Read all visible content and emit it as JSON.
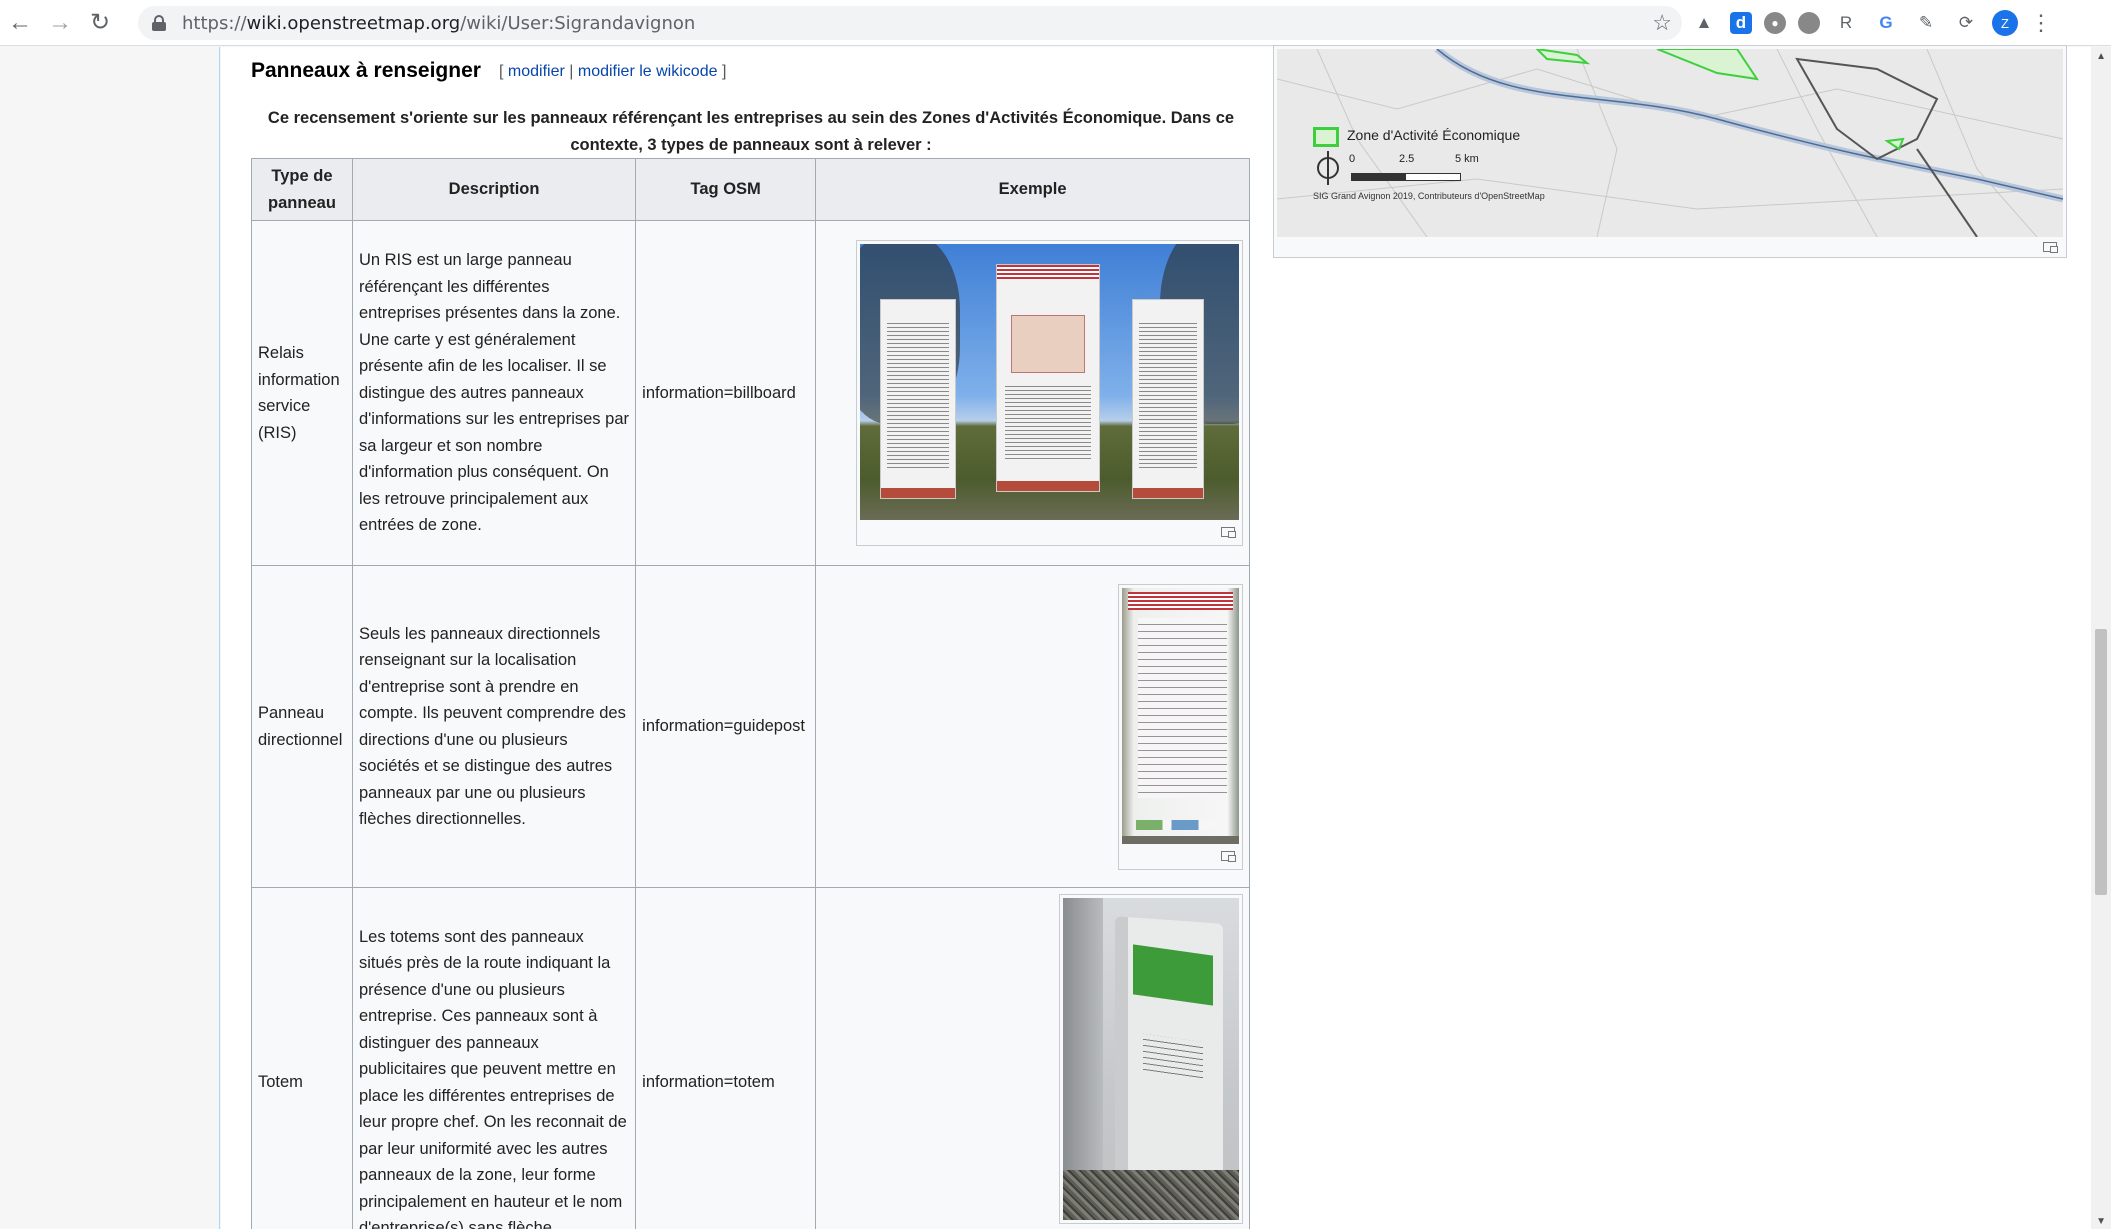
{
  "browser": {
    "url_scheme": "https://",
    "url_host": "wiki.openstreetmap.org",
    "url_path": "/wiki/User:Sigrandavignon",
    "profile_initial": "Z"
  },
  "section": {
    "title": "Panneaux à renseigner",
    "edit_open": "[",
    "edit_link": "modifier",
    "edit_sep": "|",
    "edit_wikicode_link": "modifier le wikicode",
    "edit_close": "]",
    "intro": "Ce recensement s'oriente sur les panneaux référençant les entreprises au sein des Zones d'Activités Économique. Dans ce contexte, 3 types de panneaux sont à relever :"
  },
  "table": {
    "headers": {
      "type": "Type de panneau",
      "description": "Description",
      "tag": "Tag OSM",
      "example": "Exemple"
    },
    "rows": [
      {
        "type": "Relais information service (RIS)",
        "description": "Un RIS est un large panneau référençant les différentes entreprises présentes dans la zone. Une carte y est généralement présente afin de les localiser. Il se distingue des autres panneaux d'informations sur les entreprises par sa largeur et son nombre d'information plus conséquent. On les retrouve principalement aux entrées de zone.",
        "tag": "information=billboard"
      },
      {
        "type": "Panneau directionnel",
        "description": "Seuls les panneaux directionnels renseignant sur la localisation d'entreprise sont à prendre en compte. Ils peuvent comprendre des directions d'une ou plusieurs sociétés et se distingue des autres panneaux par une ou plusieurs flèches directionnelles.",
        "tag": "information=guidepost"
      },
      {
        "type": "Totem",
        "description": "Les totems sont des panneaux situés près de la route indiquant la présence d'une ou plusieurs entreprise. Ces panneaux sont à distinguer des panneaux publicitaires que peuvent mettre en place les différentes entreprises de leur propre chef. On les reconnait de par leur uniformité avec les autres panneaux de la zone, leur forme principalement en hauteur et le nom d'entreprise(s) sans flèche.",
        "tag": "information=totem"
      }
    ]
  },
  "map": {
    "legend_label": "Zone d'Activité Économique",
    "scale_0": "0",
    "scale_mid": "2.5",
    "scale_end": "5 km",
    "credit": "SIG Grand Avignon 2019, Contributeurs d'OpenStreetMap"
  },
  "colors": {
    "link": "#0645ad",
    "zone_green": "#3ecf3e",
    "header_bg": "#eaecf0",
    "cell_bg": "#f8f9fa"
  },
  "icons": [
    "back-arrow-icon",
    "forward-arrow-icon",
    "reload-icon",
    "lock-icon",
    "star-icon",
    "extension-icons",
    "profile-avatar",
    "menu-dots-icon",
    "magnify-icon",
    "compass-icon"
  ]
}
